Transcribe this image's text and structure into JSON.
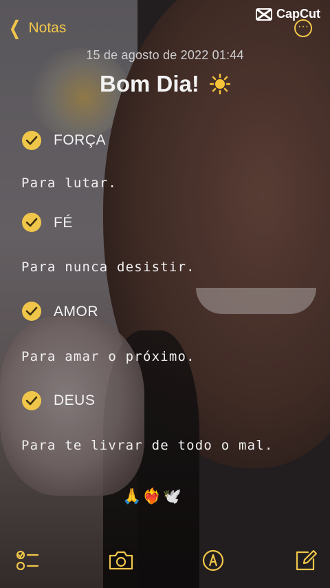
{
  "header": {
    "back_label": "Notas",
    "brand": "CapCut"
  },
  "note": {
    "date": "15 de agosto de 2022 01:44",
    "title": "Bom Dia!",
    "items": [
      {
        "label": "FORÇA",
        "text": "Para lutar."
      },
      {
        "label": "FÉ",
        "text": "Para nunca desistir."
      },
      {
        "label": "AMOR",
        "text": "Para amar o próximo."
      },
      {
        "label": "DEUS",
        "text": "Para te livrar de todo o mal."
      }
    ],
    "emojis": "🙏❤️‍🔥🕊️"
  },
  "colors": {
    "accent": "#f0c64a"
  },
  "toolbar": {
    "icons": [
      "checklist-icon",
      "camera-icon",
      "markup-pen-icon",
      "compose-icon"
    ]
  }
}
